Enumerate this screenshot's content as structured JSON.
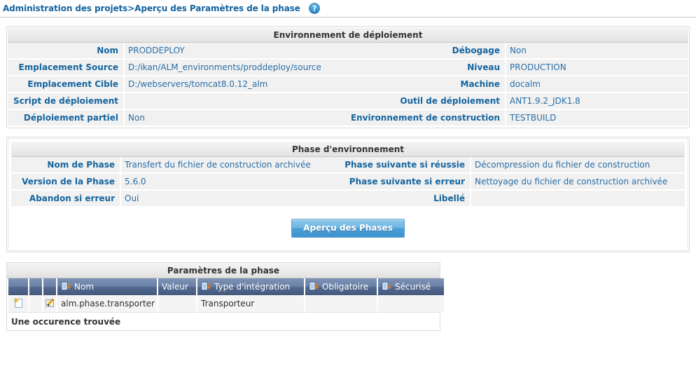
{
  "header": {
    "breadcrumb": "Administration des projets>Aperçu des Paramètres de la phase",
    "help_icon": "help-circle-icon",
    "link_color": "#1464a0"
  },
  "deployment_environment": {
    "title": "Environnement de déploiement",
    "left_rows": [
      {
        "label": "Nom",
        "value": "PRODDEPLOY"
      },
      {
        "label": "Emplacement Source",
        "value": "D:/ikan/ALM_environments/proddeploy/source"
      },
      {
        "label": "Emplacement Cible",
        "value": "D:/webservers/tomcat8.0.12_alm"
      },
      {
        "label": "Script de déploiement",
        "value": ""
      },
      {
        "label": "Déploiement partiel",
        "value": "Non"
      }
    ],
    "right_rows": [
      {
        "label": "Débogage",
        "value": "Non"
      },
      {
        "label": "Niveau",
        "value": "PRODUCTION"
      },
      {
        "label": "Machine",
        "value": "docalm"
      },
      {
        "label": "Outil de déploiement",
        "value": "ANT1.9.2_JDK1.8"
      },
      {
        "label": "Environnement de construction",
        "value": "TESTBUILD"
      }
    ]
  },
  "environment_phase": {
    "title": "Phase d'environnement",
    "left_rows": [
      {
        "label": "Nom de Phase",
        "value": "Transfert du fichier de construction archivée"
      },
      {
        "label": "Version de la Phase",
        "value": "5.6.0"
      },
      {
        "label": "Abandon si erreur",
        "value": "Oui"
      }
    ],
    "right_rows": [
      {
        "label": "Phase suivante si réussie",
        "value": "Décompression du fichier de construction"
      },
      {
        "label": "Phase suivante si erreur",
        "value": "Nettoyage du fichier de construction archivée"
      },
      {
        "label": "Libellé",
        "value": ""
      }
    ],
    "action_button": "Aperçu des Phases"
  },
  "phase_parameters": {
    "title": "Paramètres de la phase",
    "columns": [
      {
        "label": "",
        "sortable": false,
        "icon": ""
      },
      {
        "label": "",
        "sortable": false,
        "icon": ""
      },
      {
        "label": "",
        "sortable": false,
        "icon": ""
      },
      {
        "label": "Nom",
        "sortable": true,
        "icon": "sort-icon"
      },
      {
        "label": "Valeur",
        "sortable": false,
        "icon": ""
      },
      {
        "label": "Type d'intégration",
        "sortable": true,
        "icon": "sort-icon"
      },
      {
        "label": "Obligatoire",
        "sortable": true,
        "icon": "sort-icon"
      },
      {
        "label": "Sécurisé",
        "sortable": true,
        "icon": "sort-icon"
      }
    ],
    "rows": [
      {
        "new_icon": "new-document-icon",
        "edit_icon": "edit-document-icon",
        "name": "alm.phase.transporter",
        "value": "",
        "integration_type": "Transporteur",
        "mandatory": "",
        "secure": ""
      }
    ],
    "footer": "Une occurence trouvée"
  },
  "colors": {
    "label_blue": "#15659e",
    "value_blue": "#2a6ea6",
    "header_slate": "#51688f",
    "button_blue": "#4a9fd8",
    "row_grey": "#f1f1f1"
  }
}
